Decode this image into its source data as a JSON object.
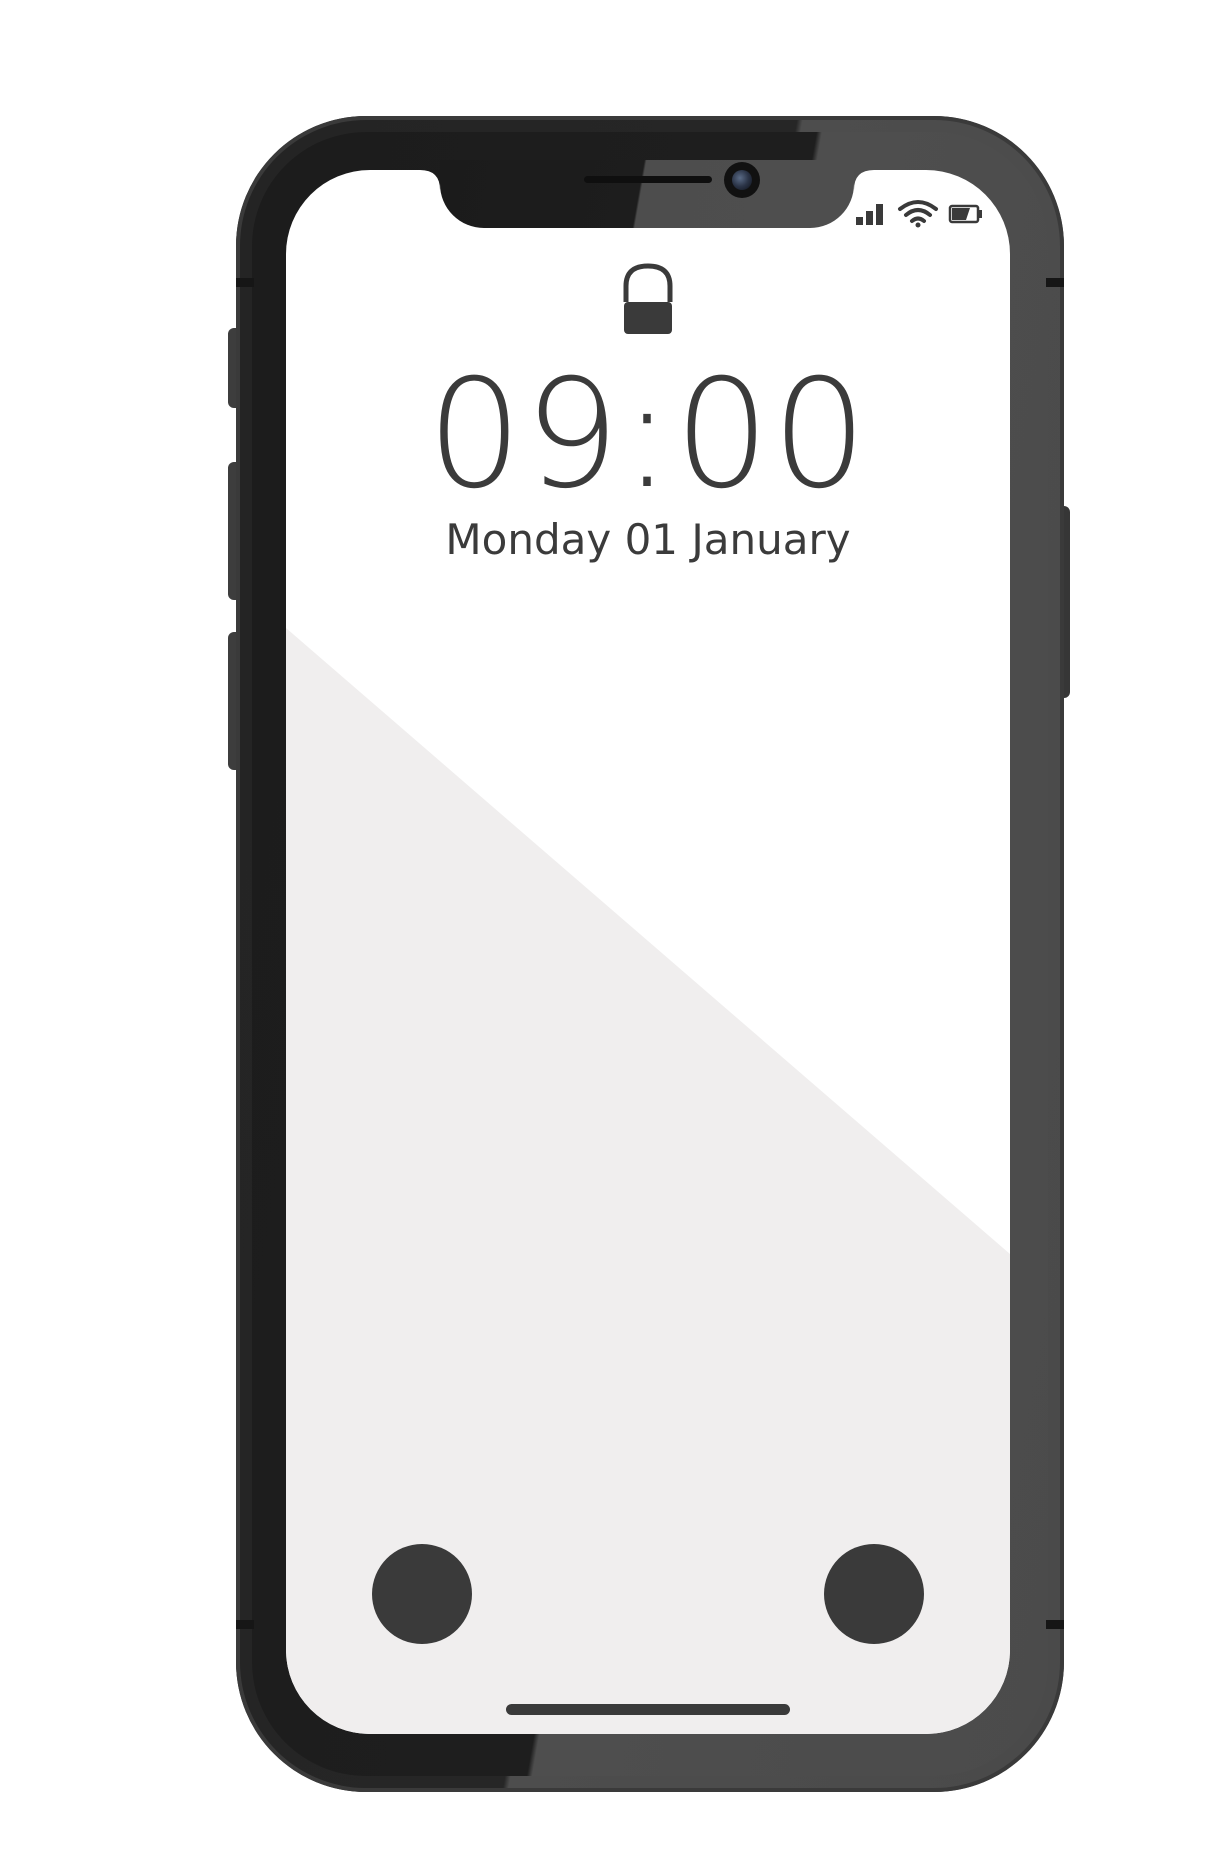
{
  "lockscreen": {
    "time": "09:00",
    "date": "Monday 01 January"
  },
  "status_bar": {
    "icons": [
      "signal-icon",
      "wifi-icon",
      "battery-icon"
    ]
  },
  "icons": {
    "lock": "lock-icon",
    "left_action": "left-action-icon",
    "right_action": "right-action-icon"
  },
  "colors": {
    "frame_dark": "#1e1e1e",
    "frame_light": "#4b4b4b",
    "screen_top": "#ffffff",
    "screen_bottom": "#f0eeee",
    "text": "#3b3b3b"
  }
}
